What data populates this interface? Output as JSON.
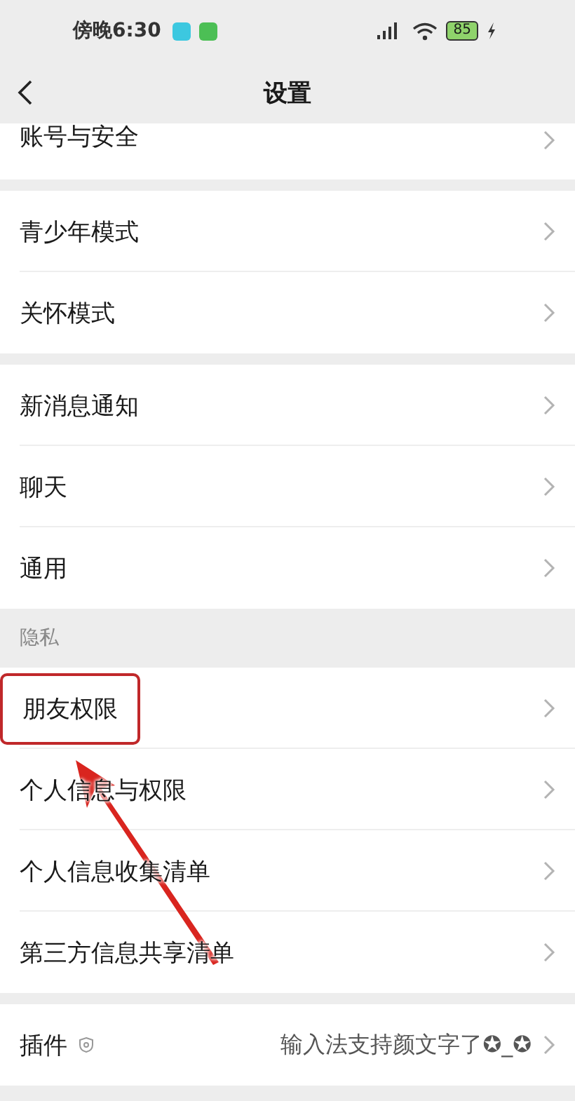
{
  "status_bar": {
    "time": "傍晚6:30",
    "battery": "85"
  },
  "nav": {
    "title": "设置"
  },
  "groups": [
    {
      "items": [
        {
          "label": "账号与安全",
          "cut": true,
          "highlighted": false
        }
      ]
    },
    {
      "items": [
        {
          "label": "青少年模式",
          "highlighted": false
        },
        {
          "label": "关怀模式",
          "highlighted": false
        }
      ]
    },
    {
      "items": [
        {
          "label": "新消息通知",
          "highlighted": false
        },
        {
          "label": "聊天",
          "highlighted": false
        },
        {
          "label": "通用",
          "highlighted": false
        }
      ]
    },
    {
      "header": "隐私",
      "items": [
        {
          "label": "朋友权限",
          "highlighted": true
        },
        {
          "label": "个人信息与权限",
          "highlighted": false
        },
        {
          "label": "个人信息收集清单",
          "highlighted": false
        },
        {
          "label": "第三方信息共享清单",
          "highlighted": false
        }
      ]
    },
    {
      "items": [
        {
          "label": "插件",
          "badge_icon": true,
          "value": "输入法支持颜文字了✪_✪",
          "highlighted": false
        }
      ]
    }
  ]
}
